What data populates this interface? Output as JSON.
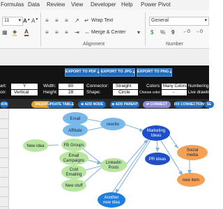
{
  "menu": [
    "Formulas",
    "Data",
    "Review",
    "View",
    "Developer",
    "Help",
    "Power Pivot"
  ],
  "ribbon": {
    "font_size": "11",
    "wrap_text": "Wrap Text",
    "merge_center": "Merge & Center",
    "number_format": "General",
    "alignment_label": "Alignment",
    "number_label": "Number"
  },
  "export": {
    "pdf": "EXPORT TO PDF",
    "jpg": "EXPORT TO JPG",
    "png": "EXPORT TO PNG"
  },
  "settings": {
    "r1": {
      "c1": "art:",
      "c2": "Y",
      "c3": "Width:",
      "c4": "80",
      "c5": "Connector:",
      "c6": "Straight",
      "c7": "Colors:",
      "c8": "Many Colors",
      "c9": "Numbering"
    },
    "r2": {
      "c1": "on:",
      "c2": "Vertical",
      "c3": "Height:",
      "c4": "28",
      "c5": "Shape:",
      "c6": "Circle",
      "c7": "Choose color:",
      "c8": "-",
      "c9": "Live drawing"
    }
  },
  "toolbar": {
    "first": "ION",
    "redraw": "[RE]DRAW",
    "update_table": "UPDATE TABLE",
    "add_node": "ADD NODE",
    "add_parent": "ADD PARENT",
    "connect": "CONNECT",
    "fix_connections": "FIX CONNECTIONS",
    "last": "SE"
  },
  "nodes": {
    "email": "Email",
    "affiliate": "Affiliate",
    "rewrite": "rewrite",
    "marketing": "Marketing Ideas",
    "new_idea": "New idea",
    "fb_groups": "FB Groups",
    "email_campaigns": "Email Campaigns",
    "cold_emailing": "Cold Emailing",
    "new_stuff": "New stuff",
    "linkedin": "LinkedIn Posts",
    "pr_ideas": "PR ideas",
    "social_media": "Social media",
    "another_idea": "Another new idea",
    "new_item": "new item"
  },
  "colors": {
    "green_node": "#b8e6a0",
    "blue_node": "#79b8ea",
    "dark_blue_node": "#1d50c8",
    "orange_node": "#f4a055",
    "button_blue": "#1d6fc4"
  }
}
